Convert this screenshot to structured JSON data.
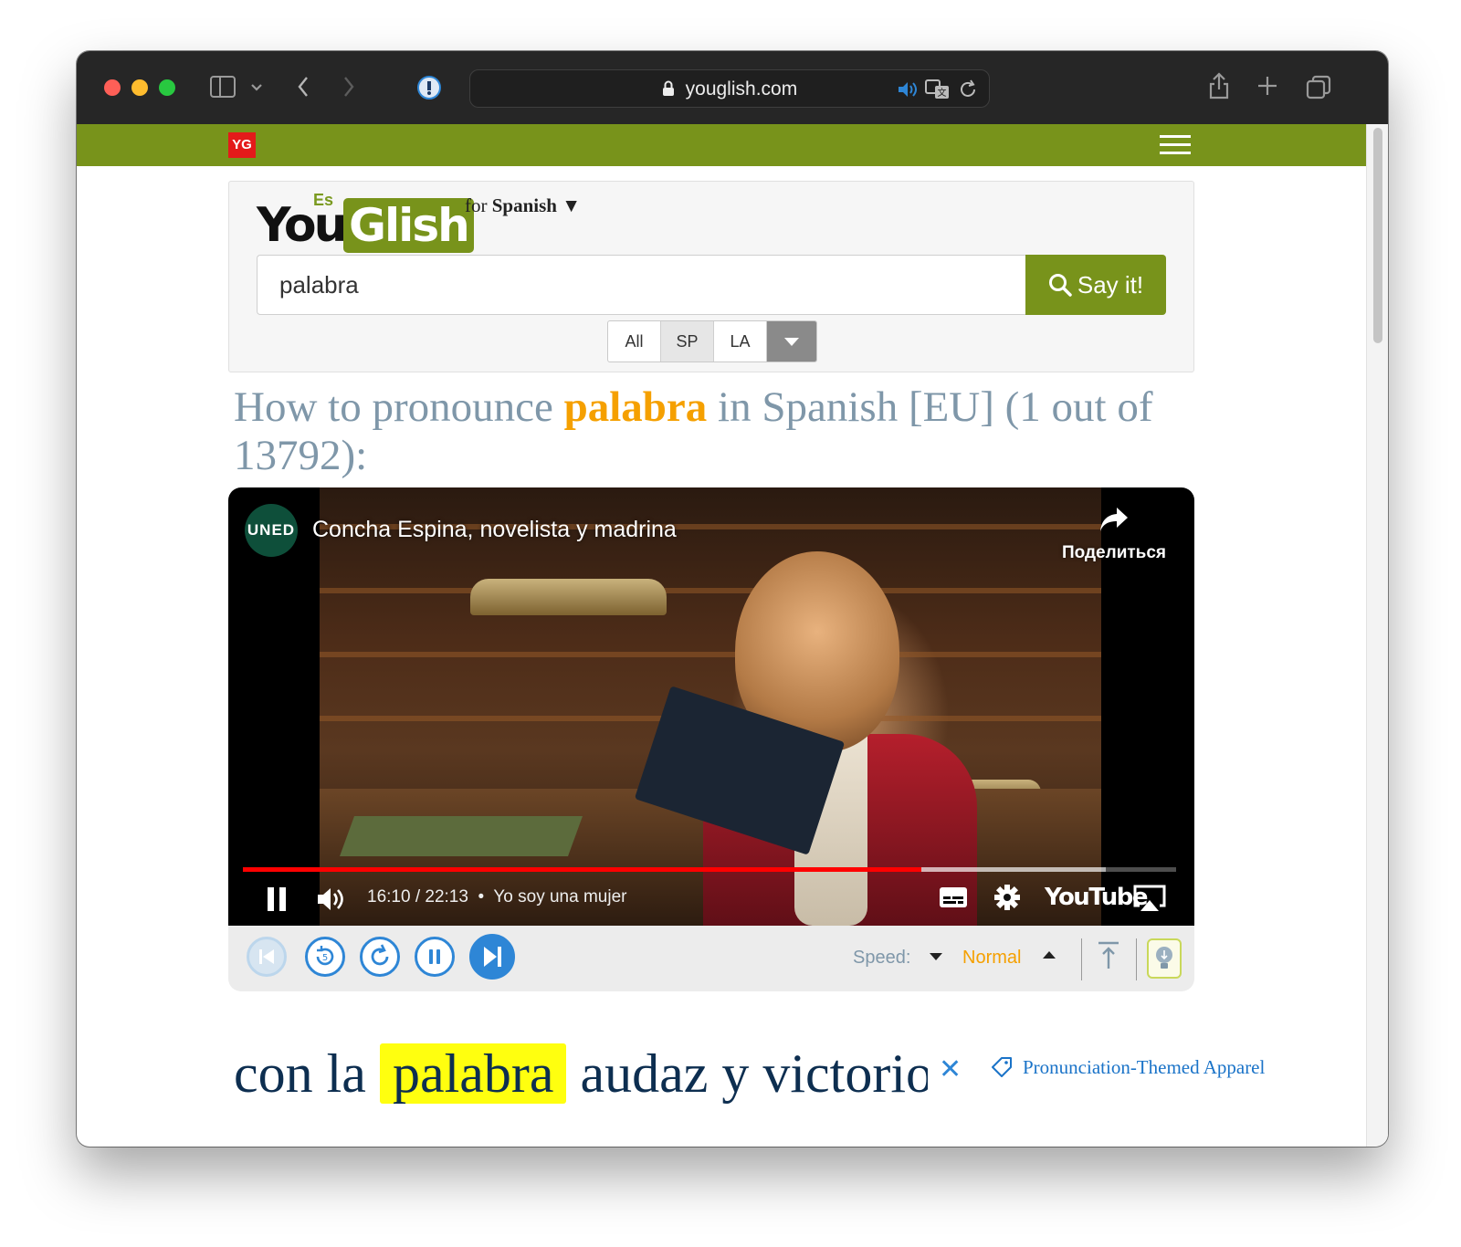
{
  "browser": {
    "url": "youglish.com"
  },
  "site": {
    "badge": "YG"
  },
  "logo": {
    "you": "You",
    "es": "Es",
    "glish": "Glish"
  },
  "language_selector": {
    "prefix": "for",
    "language": "Spanish",
    "arrow": "▼"
  },
  "search": {
    "value": "palabra",
    "button_label": "Say it!"
  },
  "filters": [
    {
      "label": "All",
      "active": false
    },
    {
      "label": "SP",
      "active": true
    },
    {
      "label": "LA",
      "active": false
    }
  ],
  "heading": {
    "prefix": "How to pronounce ",
    "keyword": "palabra",
    "suffix": " in Spanish [EU] (1 out of 13792):"
  },
  "video": {
    "channel_logo": "UNED",
    "title": "Concha Espina, novelista y madrina",
    "share_label": "Поделиться",
    "time": "16:10 / 22:13",
    "chapter": "Yo soy una mujer",
    "brand": "YouTube",
    "played_fraction": 0.727,
    "loaded_fraction": 0.925
  },
  "controls": {
    "speed_label": "Speed:",
    "speed_value": "Normal"
  },
  "caption": {
    "before": "con la",
    "highlight": "palabra",
    "after": "audaz y victoriosa"
  },
  "apparel_link": "Pronunciation-Themed Apparel",
  "colors": {
    "brand_green": "#78931b",
    "accent_orange": "#f5a000",
    "control_blue": "#2e86d6",
    "heading_gray": "#7f97a9",
    "highlight_yellow": "#ffff0f"
  }
}
